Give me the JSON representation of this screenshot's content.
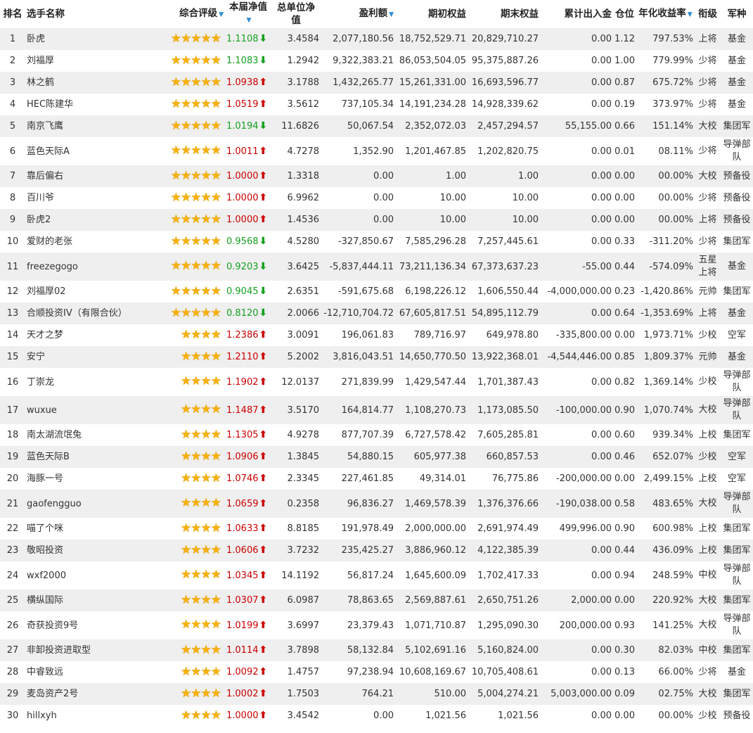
{
  "headers": {
    "rank": "排名",
    "name": "选手名称",
    "rating": "综合评级",
    "nav": "本届净值",
    "unit_nav": "总单位净值",
    "profit": "盈利额",
    "start_equity": "期初权益",
    "end_equity": "期末权益",
    "net_flow": "累计出入金",
    "position": "仓位",
    "annual_return": "年化收益率",
    "title": "衔级",
    "branch": "军种"
  },
  "colors": {
    "up": "#cc0000",
    "down": "#15a020",
    "star": "#f7b10a",
    "sort_arrow": "#2a8ad5",
    "stripe": "#efefef"
  },
  "rows": [
    {
      "rank": "1",
      "name": "卧虎",
      "stars": 5,
      "nav": "1.1108",
      "dir": "down",
      "unit_nav": "3.4584",
      "profit": "2,077,180.56",
      "start_equity": "18,752,529.71",
      "end_equity": "20,829,710.27",
      "net_flow": "0.00",
      "position": "1.12",
      "annual_return": "797.53%",
      "title": "上将",
      "branch": "基金"
    },
    {
      "rank": "2",
      "name": "刘福厚",
      "stars": 5,
      "nav": "1.1083",
      "dir": "down",
      "unit_nav": "1.2942",
      "profit": "9,322,383.21",
      "start_equity": "86,053,504.05",
      "end_equity": "95,375,887.26",
      "net_flow": "0.00",
      "position": "1.00",
      "annual_return": "779.99%",
      "title": "少将",
      "branch": "基金"
    },
    {
      "rank": "3",
      "name": "林之鹤",
      "stars": 5,
      "nav": "1.0938",
      "dir": "up",
      "unit_nav": "3.1788",
      "profit": "1,432,265.77",
      "start_equity": "15,261,331.00",
      "end_equity": "16,693,596.77",
      "net_flow": "0.00",
      "position": "0.87",
      "annual_return": "675.72%",
      "title": "少将",
      "branch": "基金"
    },
    {
      "rank": "4",
      "name": "HEC陈建华",
      "stars": 5,
      "nav": "1.0519",
      "dir": "up",
      "unit_nav": "3.5612",
      "profit": "737,105.34",
      "start_equity": "14,191,234.28",
      "end_equity": "14,928,339.62",
      "net_flow": "0.00",
      "position": "0.19",
      "annual_return": "373.97%",
      "title": "少将",
      "branch": "基金"
    },
    {
      "rank": "5",
      "name": "南京飞鹰",
      "stars": 5,
      "nav": "1.0194",
      "dir": "down",
      "unit_nav": "11.6826",
      "profit": "50,067.54",
      "start_equity": "2,352,072.03",
      "end_equity": "2,457,294.57",
      "net_flow": "55,155.00",
      "position": "0.66",
      "annual_return": "151.14%",
      "title": "大校",
      "branch": "集团军"
    },
    {
      "rank": "6",
      "name": "蓝色天际A",
      "stars": 5,
      "nav": "1.0011",
      "dir": "up",
      "unit_nav": "4.7278",
      "profit": "1,352.90",
      "start_equity": "1,201,467.85",
      "end_equity": "1,202,820.75",
      "net_flow": "0.00",
      "position": "0.01",
      "annual_return": "08.11%",
      "title": "少将",
      "branch": "导弹部队"
    },
    {
      "rank": "7",
      "name": "靠后偏右",
      "stars": 5,
      "nav": "1.0000",
      "dir": "up",
      "unit_nav": "1.3318",
      "profit": "0.00",
      "start_equity": "1.00",
      "end_equity": "1.00",
      "net_flow": "0.00",
      "position": "0.00",
      "annual_return": "00.00%",
      "title": "大校",
      "branch": "预备役"
    },
    {
      "rank": "8",
      "name": "百川爷",
      "stars": 5,
      "nav": "1.0000",
      "dir": "up",
      "unit_nav": "6.9962",
      "profit": "0.00",
      "start_equity": "10.00",
      "end_equity": "10.00",
      "net_flow": "0.00",
      "position": "0.00",
      "annual_return": "00.00%",
      "title": "少将",
      "branch": "预备役"
    },
    {
      "rank": "9",
      "name": "卧虎2",
      "stars": 5,
      "nav": "1.0000",
      "dir": "up",
      "unit_nav": "1.4536",
      "profit": "0.00",
      "start_equity": "10.00",
      "end_equity": "10.00",
      "net_flow": "0.00",
      "position": "0.00",
      "annual_return": "00.00%",
      "title": "上将",
      "branch": "预备役"
    },
    {
      "rank": "10",
      "name": "爱财的老张",
      "stars": 5,
      "nav": "0.9568",
      "dir": "down",
      "unit_nav": "4.5280",
      "profit": "-327,850.67",
      "start_equity": "7,585,296.28",
      "end_equity": "7,257,445.61",
      "net_flow": "0.00",
      "position": "0.33",
      "annual_return": "-311.20%",
      "title": "少将",
      "branch": "集团军"
    },
    {
      "rank": "11",
      "name": "freezegogo",
      "stars": 5,
      "nav": "0.9203",
      "dir": "down",
      "unit_nav": "3.6425",
      "profit": "-5,837,444.11",
      "start_equity": "73,211,136.34",
      "end_equity": "67,373,637.23",
      "net_flow": "-55.00",
      "position": "0.44",
      "annual_return": "-574.09%",
      "title": "五星上将",
      "branch": "基金"
    },
    {
      "rank": "12",
      "name": "刘福厚02",
      "stars": 5,
      "nav": "0.9045",
      "dir": "down",
      "unit_nav": "2.6351",
      "profit": "-591,675.68",
      "start_equity": "6,198,226.12",
      "end_equity": "1,606,550.44",
      "net_flow": "-4,000,000.00",
      "position": "0.23",
      "annual_return": "-1,420.86%",
      "title": "元帅",
      "branch": "集团军"
    },
    {
      "rank": "13",
      "name": "合顺投资IV（有限合伙）",
      "stars": 5,
      "nav": "0.8120",
      "dir": "down",
      "unit_nav": "2.0066",
      "profit": "-12,710,704.72",
      "start_equity": "67,605,817.51",
      "end_equity": "54,895,112.79",
      "net_flow": "0.00",
      "position": "0.64",
      "annual_return": "-1,353.69%",
      "title": "上将",
      "branch": "基金"
    },
    {
      "rank": "14",
      "name": "天才之梦",
      "stars": 4,
      "nav": "1.2386",
      "dir": "up",
      "unit_nav": "3.0091",
      "profit": "196,061.83",
      "start_equity": "789,716.97",
      "end_equity": "649,978.80",
      "net_flow": "-335,800.00",
      "position": "0.00",
      "annual_return": "1,973.71%",
      "title": "少校",
      "branch": "空军"
    },
    {
      "rank": "15",
      "name": "安宁",
      "stars": 4,
      "nav": "1.2110",
      "dir": "up",
      "unit_nav": "5.2002",
      "profit": "3,816,043.51",
      "start_equity": "14,650,770.50",
      "end_equity": "13,922,368.01",
      "net_flow": "-4,544,446.00",
      "position": "0.85",
      "annual_return": "1,809.37%",
      "title": "元帅",
      "branch": "基金"
    },
    {
      "rank": "16",
      "name": "丁崇龙",
      "stars": 4,
      "nav": "1.1902",
      "dir": "up",
      "unit_nav": "12.0137",
      "profit": "271,839.99",
      "start_equity": "1,429,547.44",
      "end_equity": "1,701,387.43",
      "net_flow": "0.00",
      "position": "0.82",
      "annual_return": "1,369.14%",
      "title": "少校",
      "branch": "导弹部队"
    },
    {
      "rank": "17",
      "name": "wuxue",
      "stars": 4,
      "nav": "1.1487",
      "dir": "up",
      "unit_nav": "3.5170",
      "profit": "164,814.77",
      "start_equity": "1,108,270.73",
      "end_equity": "1,173,085.50",
      "net_flow": "-100,000.00",
      "position": "0.90",
      "annual_return": "1,070.74%",
      "title": "大校",
      "branch": "导弹部队"
    },
    {
      "rank": "18",
      "name": "南太湖流氓兔",
      "stars": 4,
      "nav": "1.1305",
      "dir": "up",
      "unit_nav": "4.9278",
      "profit": "877,707.39",
      "start_equity": "6,727,578.42",
      "end_equity": "7,605,285.81",
      "net_flow": "0.00",
      "position": "0.60",
      "annual_return": "939.34%",
      "title": "上校",
      "branch": "集团军"
    },
    {
      "rank": "19",
      "name": "蓝色天际B",
      "stars": 4,
      "nav": "1.0906",
      "dir": "up",
      "unit_nav": "1.3845",
      "profit": "54,880.15",
      "start_equity": "605,977.38",
      "end_equity": "660,857.53",
      "net_flow": "0.00",
      "position": "0.46",
      "annual_return": "652.07%",
      "title": "少校",
      "branch": "空军"
    },
    {
      "rank": "20",
      "name": "海豚一号",
      "stars": 4,
      "nav": "1.0746",
      "dir": "up",
      "unit_nav": "2.3345",
      "profit": "227,461.85",
      "start_equity": "49,314.01",
      "end_equity": "76,775.86",
      "net_flow": "-200,000.00",
      "position": "0.00",
      "annual_return": "2,499.15%",
      "title": "上校",
      "branch": "空军"
    },
    {
      "rank": "21",
      "name": "gaofengguo",
      "stars": 4,
      "nav": "1.0659",
      "dir": "up",
      "unit_nav": "0.2358",
      "profit": "96,836.27",
      "start_equity": "1,469,578.39",
      "end_equity": "1,376,376.66",
      "net_flow": "-190,038.00",
      "position": "0.58",
      "annual_return": "483.65%",
      "title": "大校",
      "branch": "导弹部队"
    },
    {
      "rank": "22",
      "name": "喵了个咪",
      "stars": 4,
      "nav": "1.0633",
      "dir": "up",
      "unit_nav": "8.8185",
      "profit": "191,978.49",
      "start_equity": "2,000,000.00",
      "end_equity": "2,691,974.49",
      "net_flow": "499,996.00",
      "position": "0.90",
      "annual_return": "600.98%",
      "title": "上校",
      "branch": "集团军"
    },
    {
      "rank": "23",
      "name": "敬昭投资",
      "stars": 4,
      "nav": "1.0606",
      "dir": "up",
      "unit_nav": "3.7232",
      "profit": "235,425.27",
      "start_equity": "3,886,960.12",
      "end_equity": "4,122,385.39",
      "net_flow": "0.00",
      "position": "0.44",
      "annual_return": "436.09%",
      "title": "上校",
      "branch": "集团军"
    },
    {
      "rank": "24",
      "name": "wxf2000",
      "stars": 4,
      "nav": "1.0345",
      "dir": "up",
      "unit_nav": "14.1192",
      "profit": "56,817.24",
      "start_equity": "1,645,600.09",
      "end_equity": "1,702,417.33",
      "net_flow": "0.00",
      "position": "0.94",
      "annual_return": "248.59%",
      "title": "中校",
      "branch": "导弹部队"
    },
    {
      "rank": "25",
      "name": "横纵国际",
      "stars": 4,
      "nav": "1.0307",
      "dir": "up",
      "unit_nav": "6.0987",
      "profit": "78,863.65",
      "start_equity": "2,569,887.61",
      "end_equity": "2,650,751.26",
      "net_flow": "2,000.00",
      "position": "0.00",
      "annual_return": "220.92%",
      "title": "大校",
      "branch": "集团军"
    },
    {
      "rank": "26",
      "name": "奇获投资9号",
      "stars": 4,
      "nav": "1.0199",
      "dir": "up",
      "unit_nav": "3.6997",
      "profit": "23,379.43",
      "start_equity": "1,071,710.87",
      "end_equity": "1,295,090.30",
      "net_flow": "200,000.00",
      "position": "0.93",
      "annual_return": "141.25%",
      "title": "大校",
      "branch": "导弹部队"
    },
    {
      "rank": "27",
      "name": "非卸投资进取型",
      "stars": 4,
      "nav": "1.0114",
      "dir": "up",
      "unit_nav": "3.7898",
      "profit": "58,132.84",
      "start_equity": "5,102,691.16",
      "end_equity": "5,160,824.00",
      "net_flow": "0.00",
      "position": "0.30",
      "annual_return": "82.03%",
      "title": "中校",
      "branch": "集团军"
    },
    {
      "rank": "28",
      "name": "中睿致远",
      "stars": 4,
      "nav": "1.0092",
      "dir": "up",
      "unit_nav": "1.4757",
      "profit": "97,238.94",
      "start_equity": "10,608,169.67",
      "end_equity": "10,705,408.61",
      "net_flow": "0.00",
      "position": "0.13",
      "annual_return": "66.00%",
      "title": "少将",
      "branch": "基金"
    },
    {
      "rank": "29",
      "name": "麦岛资产2号",
      "stars": 4,
      "nav": "1.0002",
      "dir": "up",
      "unit_nav": "1.7503",
      "profit": "764.21",
      "start_equity": "510.00",
      "end_equity": "5,004,274.21",
      "net_flow": "5,003,000.00",
      "position": "0.09",
      "annual_return": "02.75%",
      "title": "大校",
      "branch": "集团军"
    },
    {
      "rank": "30",
      "name": "hillxyh",
      "stars": 4,
      "nav": "1.0000",
      "dir": "up",
      "unit_nav": "3.4542",
      "profit": "0.00",
      "start_equity": "1,021.56",
      "end_equity": "1,021.56",
      "net_flow": "0.00",
      "position": "0.00",
      "annual_return": "00.00%",
      "title": "少校",
      "branch": "预备役"
    }
  ]
}
